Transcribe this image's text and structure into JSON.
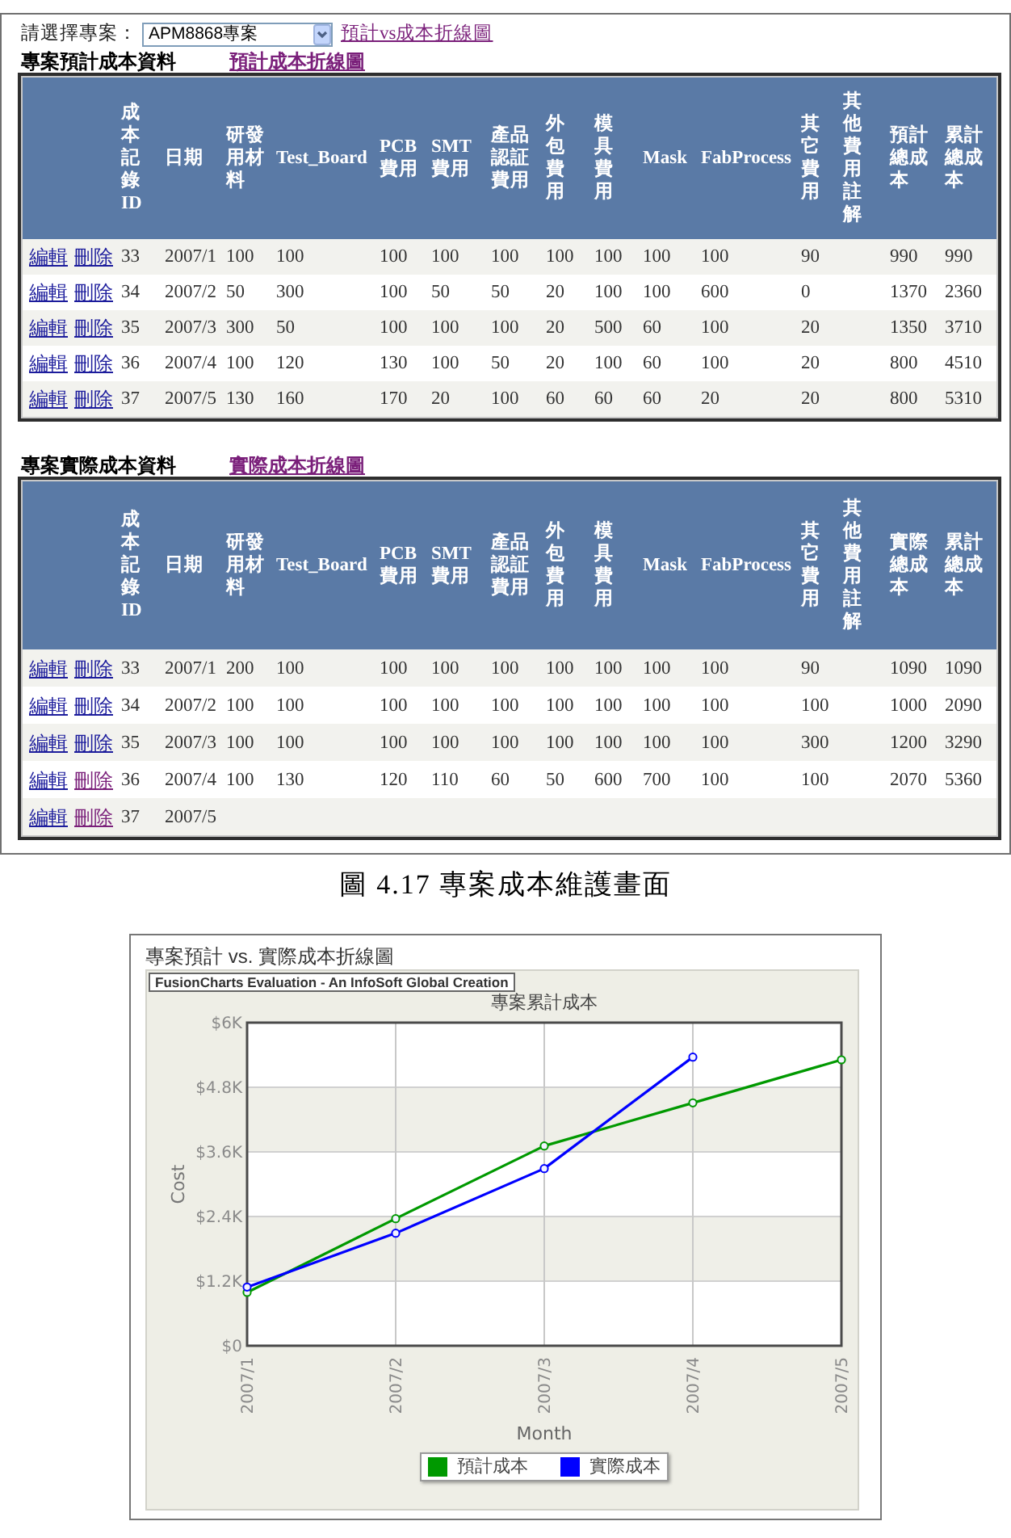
{
  "project_selector": {
    "label": "請選擇專案：",
    "value": "APM8868專案",
    "link": {
      "label": "預計vs成本折線圖",
      "visited": true
    }
  },
  "sections": [
    {
      "title": "專案預計成本資料",
      "link": {
        "label": "預計成本折線圖",
        "visited": true
      },
      "table": {
        "columns": [
          "成本記錄ID",
          "日期",
          "研發用材料",
          "Test_Board",
          "PCB費用",
          "SMT費用",
          "產品認証費用",
          "外包費用",
          "模具費用",
          "Mask",
          "FabProcess",
          "其它費用",
          "其他費用註解",
          "預計總成本",
          "累計總成本"
        ],
        "rows": [
          {
            "actions": [
              {
                "label": "編輯",
                "visited": false
              },
              {
                "label": "刪除",
                "visited": false
              }
            ],
            "cells": [
              "33",
              "2007/1",
              "100",
              "100",
              "100",
              "100",
              "100",
              "100",
              "100",
              "100",
              "100",
              "90",
              null,
              "990",
              "990"
            ]
          },
          {
            "actions": [
              {
                "label": "編輯",
                "visited": false
              },
              {
                "label": "刪除",
                "visited": false
              }
            ],
            "cells": [
              "34",
              "2007/2",
              "50",
              "300",
              "100",
              "50",
              "50",
              "20",
              "100",
              "100",
              "600",
              "0",
              null,
              "1370",
              "2360"
            ]
          },
          {
            "actions": [
              {
                "label": "編輯",
                "visited": false
              },
              {
                "label": "刪除",
                "visited": false
              }
            ],
            "cells": [
              "35",
              "2007/3",
              "300",
              "50",
              "100",
              "100",
              "100",
              "20",
              "500",
              "60",
              "100",
              "20",
              null,
              "1350",
              "3710"
            ]
          },
          {
            "actions": [
              {
                "label": "編輯",
                "visited": false
              },
              {
                "label": "刪除",
                "visited": false
              }
            ],
            "cells": [
              "36",
              "2007/4",
              "100",
              "120",
              "130",
              "100",
              "50",
              "20",
              "100",
              "60",
              "100",
              "20",
              null,
              "800",
              "4510"
            ]
          },
          {
            "actions": [
              {
                "label": "編輯",
                "visited": false
              },
              {
                "label": "刪除",
                "visited": false
              }
            ],
            "cells": [
              "37",
              "2007/5",
              "130",
              "160",
              "170",
              "20",
              "100",
              "60",
              "60",
              "60",
              "20",
              "20",
              null,
              "800",
              "5310"
            ]
          }
        ]
      }
    },
    {
      "title": "專案實際成本資料",
      "link": {
        "label": "實際成本折線圖",
        "visited": true
      },
      "table": {
        "columns": [
          "成本記錄ID",
          "日期",
          "研發用材料",
          "Test_Board",
          "PCB費用",
          "SMT費用",
          "產品認証費用",
          "外包費用",
          "模具費用",
          "Mask",
          "FabProcess",
          "其它費用",
          "其他費用註解",
          "實際總成本",
          "累計總成本"
        ],
        "rows": [
          {
            "actions": [
              {
                "label": "編輯",
                "visited": false
              },
              {
                "label": "刪除",
                "visited": false
              }
            ],
            "cells": [
              "33",
              "2007/1",
              "200",
              "100",
              "100",
              "100",
              "100",
              "100",
              "100",
              "100",
              "100",
              "90",
              null,
              "1090",
              "1090"
            ]
          },
          {
            "actions": [
              {
                "label": "編輯",
                "visited": false
              },
              {
                "label": "刪除",
                "visited": false
              }
            ],
            "cells": [
              "34",
              "2007/2",
              "100",
              "100",
              "100",
              "100",
              "100",
              "100",
              "100",
              "100",
              "100",
              "100",
              null,
              "1000",
              "2090"
            ]
          },
          {
            "actions": [
              {
                "label": "編輯",
                "visited": false
              },
              {
                "label": "刪除",
                "visited": false
              }
            ],
            "cells": [
              "35",
              "2007/3",
              "100",
              "100",
              "100",
              "100",
              "100",
              "100",
              "100",
              "100",
              "100",
              "300",
              null,
              "1200",
              "3290"
            ]
          },
          {
            "actions": [
              {
                "label": "編輯",
                "visited": false
              },
              {
                "label": "刪除",
                "visited": true
              }
            ],
            "cells": [
              "36",
              "2007/4",
              "100",
              "130",
              "120",
              "110",
              "60",
              "50",
              "600",
              "700",
              "100",
              "100",
              null,
              "2070",
              "5360"
            ]
          },
          {
            "actions": [
              {
                "label": "編輯",
                "visited": false
              },
              {
                "label": "刪除",
                "visited": true
              }
            ],
            "cells": [
              "37",
              "2007/5"
            ]
          }
        ]
      }
    }
  ],
  "caption": "圖 4.17 專案成本維護畫面",
  "chart_panel": {
    "title": "專案預計 vs. 實際成本折線圖",
    "banner": "FusionCharts Evaluation - An InfoSoft Global Creation",
    "chart_data": {
      "type": "line",
      "title": "專案累計成本",
      "xlabel": "Month",
      "ylabel": "Cost",
      "categories": [
        "2007/1",
        "2007/2",
        "2007/3",
        "2007/4",
        "2007/5"
      ],
      "series": [
        {
          "name": "預計成本",
          "color": "#009900",
          "marker": "circle",
          "values": [
            990,
            2360,
            3710,
            4510,
            5310
          ]
        },
        {
          "name": "實際成本",
          "color": "#0000ff",
          "marker": "circle",
          "values": [
            1090,
            2090,
            3290,
            5360,
            null
          ]
        }
      ],
      "ylim": [
        0,
        6000
      ],
      "yticks": [
        {
          "value": 0,
          "label": "$0"
        },
        {
          "value": 1200,
          "label": "$1.2K"
        },
        {
          "value": 2400,
          "label": "$2.4K"
        },
        {
          "value": 3600,
          "label": "$3.6K"
        },
        {
          "value": 4800,
          "label": "$4.8K"
        },
        {
          "value": 6000,
          "label": "$6K"
        }
      ],
      "grid": true,
      "legend": "bottom"
    }
  }
}
